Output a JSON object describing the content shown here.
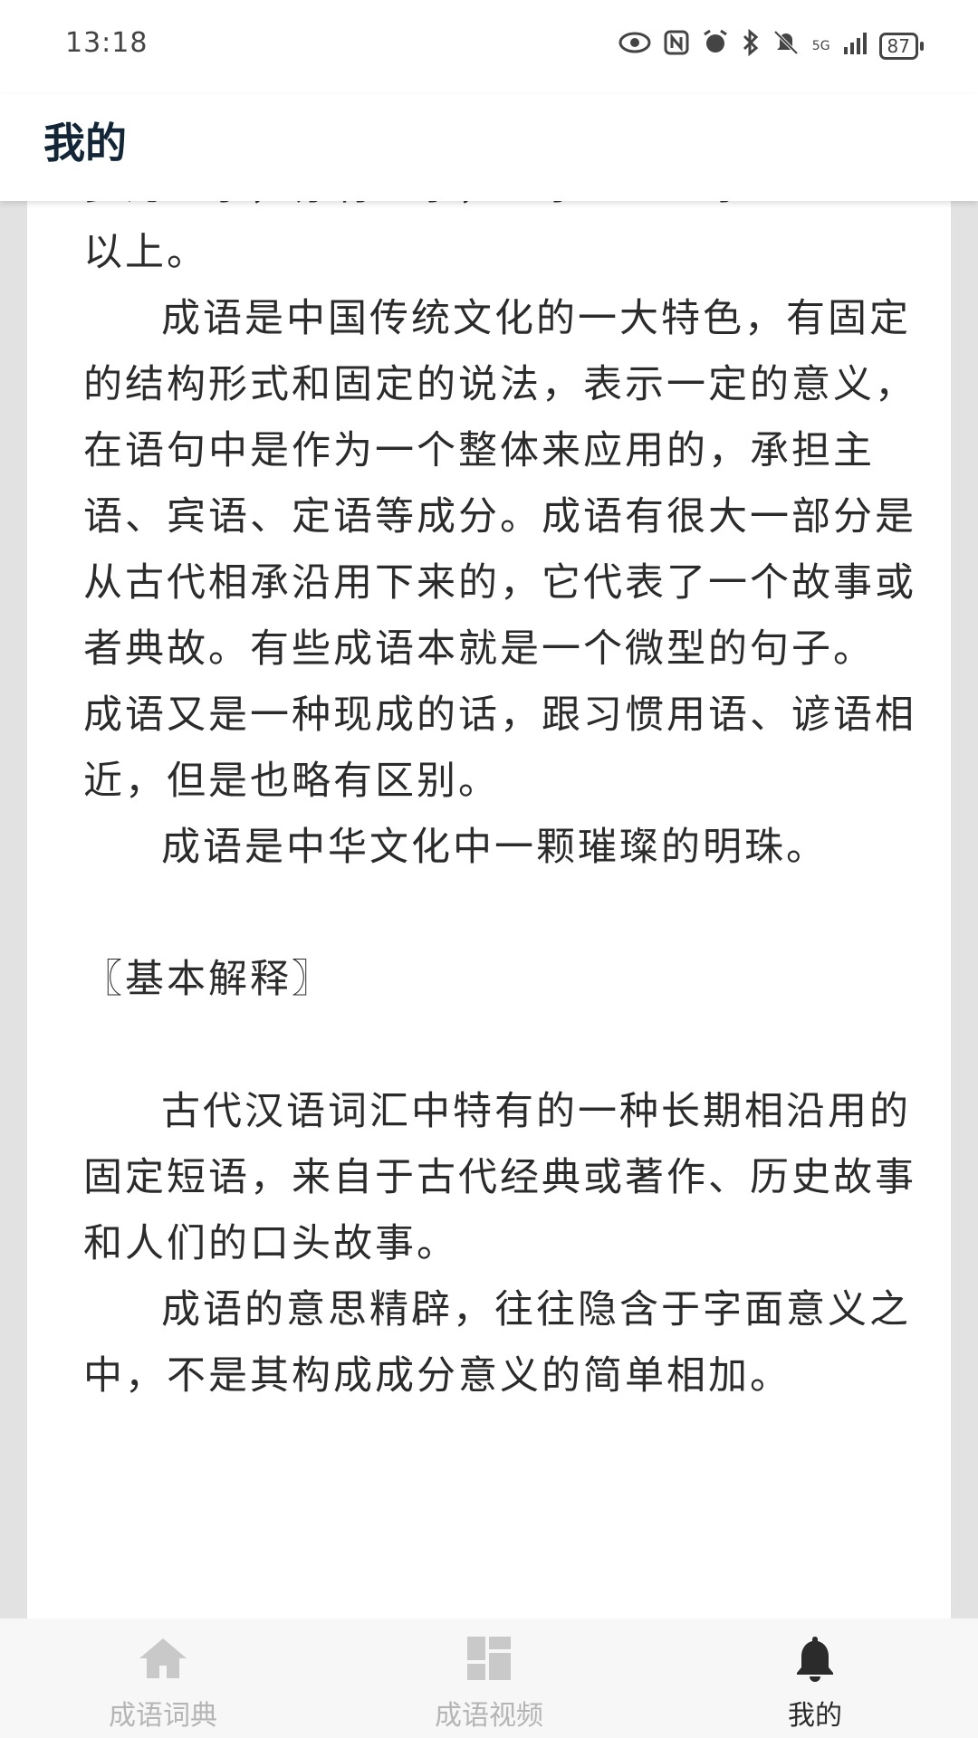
{
  "status_bar": {
    "time": "13:18",
    "network": "5G",
    "battery": "87",
    "icons": [
      "eye-icon",
      "nfc-icon",
      "alarm-icon",
      "bluetooth-icon",
      "mute-icon",
      "signal-icon",
      "battery-icon"
    ]
  },
  "header": {
    "title": "我的"
  },
  "content": {
    "top_partial": "多为四字，亦有三字，五字甚至七字",
    "p1_end": "以上。",
    "p2": "成语是中国传统文化的一大特色，有固定的结构形式和固定的说法，表示一定的意义，在语句中是作为一个整体来应用的，承担主语、宾语、定语等成分。成语有很大一部分是从古代相承沿用下来的，它代表了一个故事或者典故。有些成语本就是一个微型的句子。 成语又是一种现成的话，跟习惯用语、谚语相近，但是也略有区别。",
    "p3": "成语是中华文化中一颗璀璨的明珠。",
    "section_title": "〖基本解释〗",
    "p4": "古代汉语词汇中特有的一种长期相沿用的固定短语，来自于古代经典或著作、历史故事和人们的口头故事。",
    "p5": "成语的意思精辟，往往隐含于字面意义之中，不是其构成成分意义的简单相加。"
  },
  "bottom_nav": {
    "items": [
      {
        "label": "成语词典",
        "icon": "home-icon",
        "active": false
      },
      {
        "label": "成语视频",
        "icon": "dashboard-icon",
        "active": false
      },
      {
        "label": "我的",
        "icon": "bell-icon",
        "active": true
      }
    ]
  },
  "colors": {
    "title": "#122638",
    "text": "#2b2b2b",
    "nav_inactive": "#b5b5b5",
    "nav_active": "#2b2b2b",
    "background": "#e2e2e2"
  }
}
